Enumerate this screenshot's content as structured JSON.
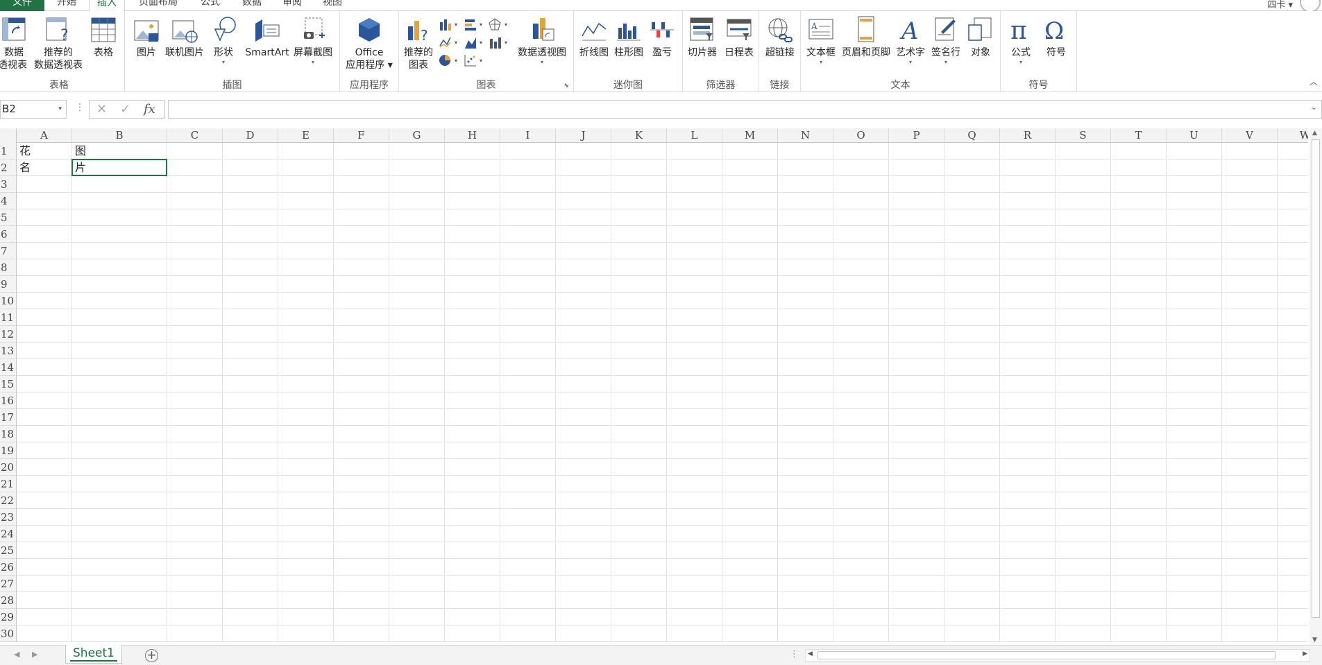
{
  "tabs": [
    {
      "label": "文件"
    },
    {
      "label": "开始"
    },
    {
      "label": "插入"
    },
    {
      "label": "页面布局"
    },
    {
      "label": "公式"
    },
    {
      "label": "数据"
    },
    {
      "label": "审阅"
    },
    {
      "label": "视图"
    }
  ],
  "account": {
    "name": "四卡 ▾"
  },
  "ribbon": {
    "groups": {
      "tables": "表格",
      "illustrations": "插图",
      "apps": "应用程序",
      "charts": "图表",
      "sparklines": "迷你图",
      "filters": "筛选器",
      "links": "链接",
      "text": "文本",
      "symbols": "符号"
    },
    "buttons": {
      "pivot_table_1": "数据",
      "pivot_table_2": "透视表",
      "rec_pivot_1": "推荐的",
      "rec_pivot_2": "数据透视表",
      "table": "表格",
      "pictures": "图片",
      "online_pictures": "联机图片",
      "shapes": "形状",
      "smartart": "SmartArt",
      "screenshot": "屏幕截图",
      "office_apps_1": "Office",
      "office_apps_2": "应用程序 ▾",
      "rec_charts_1": "推荐的",
      "rec_charts_2": "图表",
      "pivot_chart": "数据透视图",
      "line_spark": "折线图",
      "column_spark": "柱形图",
      "winloss_spark": "盈亏",
      "slicer": "切片器",
      "timeline": "日程表",
      "hyperlink": "超链接",
      "textbox": "文本框",
      "header_footer": "页眉和页脚",
      "wordart": "艺术字",
      "signature": "签名行",
      "object": "对象",
      "equation": "公式",
      "symbol": "符号"
    }
  },
  "formula_bar": {
    "name_box": "B2",
    "fx": "fx",
    "value": ""
  },
  "columns": [
    "A",
    "B",
    "C",
    "D",
    "E",
    "F",
    "G",
    "H",
    "I",
    "J",
    "K",
    "L",
    "M",
    "N",
    "O",
    "P",
    "Q",
    "R",
    "S",
    "T",
    "U",
    "V",
    "W"
  ],
  "rows": [
    "1",
    "2",
    "3",
    "4",
    "5",
    "6",
    "7",
    "8",
    "9",
    "10",
    "11",
    "12",
    "13",
    "14",
    "15",
    "16",
    "17",
    "18",
    "19",
    "20",
    "21",
    "22",
    "23",
    "24",
    "25",
    "26",
    "27",
    "28",
    "29",
    "30"
  ],
  "cells": {
    "A1": "花名",
    "B1": "图片"
  },
  "sheets": [
    {
      "label": "Sheet1"
    }
  ],
  "colors": {
    "accent": "#217346",
    "file_tab": "#217346",
    "icon_blue": "#2b579a",
    "icon_orange": "#e8a23c"
  }
}
